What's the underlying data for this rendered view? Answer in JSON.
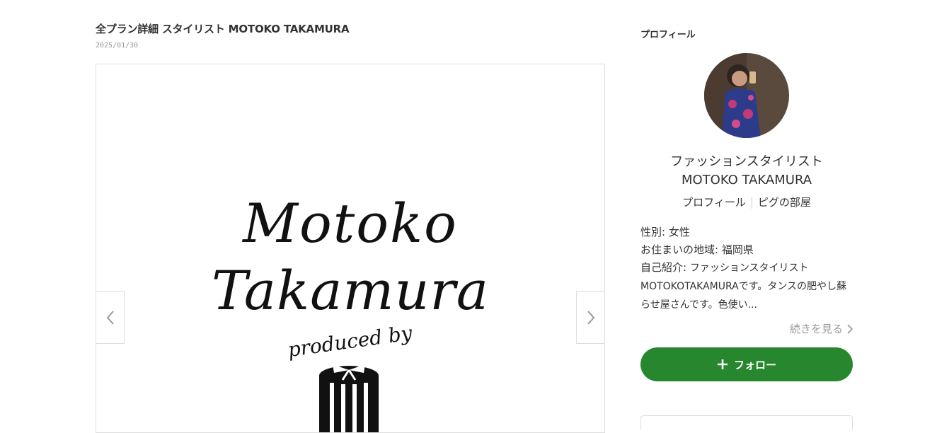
{
  "post": {
    "title": "全プラン詳細 スタイリスト MOTOKO TAKAMURA",
    "date": "2025/01/30"
  },
  "image": {
    "logo_line1": "Motoko",
    "logo_line2": "Takamura",
    "logo_line3": "produced by"
  },
  "icons": {
    "prev": "chevron-left-icon",
    "next": "chevron-right-icon",
    "readmore": "chevron-right-icon",
    "follow": "plus-icon"
  },
  "sidebar": {
    "heading": "プロフィール",
    "name": "ファッションスタイリスト MOTOKO TAKAMURA",
    "links": [
      "プロフィール",
      "ピグの部屋"
    ],
    "gender": "性別: 女性",
    "region": "お住まいの地域: 福岡県",
    "intro_label": "自己紹介: ",
    "intro_text": "ファッションスタイリストMOTOKOTAKAMURAです。タンスの肥やし蘇らせ屋さんです。色使い...",
    "readmore": "続きを見る",
    "follow": "フォロー",
    "accent": "#27872e"
  }
}
